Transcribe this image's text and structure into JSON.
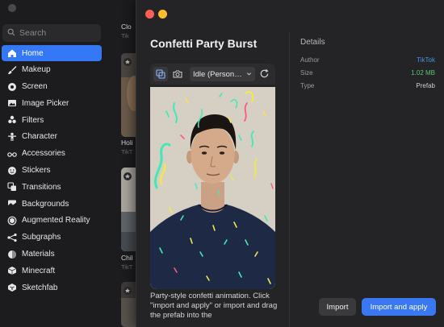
{
  "library": {
    "search": {
      "placeholder": "Search"
    },
    "nav": [
      {
        "label": "Home",
        "icon": "home-icon",
        "active": true
      },
      {
        "label": "Makeup",
        "icon": "brush-icon"
      },
      {
        "label": "Screen",
        "icon": "screen-icon"
      },
      {
        "label": "Image Picker",
        "icon": "image-icon"
      },
      {
        "label": "Filters",
        "icon": "filters-icon"
      },
      {
        "label": "Character",
        "icon": "character-icon"
      },
      {
        "label": "Accessories",
        "icon": "glasses-icon"
      },
      {
        "label": "Stickers",
        "icon": "sticker-icon"
      },
      {
        "label": "Transitions",
        "icon": "transitions-icon"
      },
      {
        "label": "Backgrounds",
        "icon": "backgrounds-icon"
      },
      {
        "label": "Augmented Reality",
        "icon": "ar-icon"
      },
      {
        "label": "Subgraphs",
        "icon": "subgraph-icon"
      },
      {
        "label": "Materials",
        "icon": "materials-icon"
      },
      {
        "label": "Minecraft",
        "icon": "minecraft-icon"
      },
      {
        "label": "Sketchfab",
        "icon": "sketchfab-icon"
      }
    ],
    "thumbs": [
      {
        "label": "Clo",
        "sub": "Tik"
      },
      {
        "label": "Holi",
        "sub": "TikT"
      },
      {
        "label": "Chil",
        "sub": "TikT"
      }
    ]
  },
  "dialog": {
    "title": "Confetti Party Burst",
    "preview": {
      "mode_select": "Idle (Person…"
    },
    "description": "Party-style confetti animation. Click \"import and apply\" or import and drag the prefab into the",
    "details": {
      "heading": "Details",
      "rows": [
        {
          "key": "Author",
          "value": "TikTok"
        },
        {
          "key": "Size",
          "value": "1.02 MB"
        },
        {
          "key": "Type",
          "value": "Prefab"
        }
      ]
    },
    "buttons": {
      "import": "Import",
      "apply": "Import and apply"
    }
  },
  "colors": {
    "accent": "#3478f6",
    "link": "#4a90e2",
    "size_green": "#57c774",
    "close": "#ff5f57",
    "minimize": "#febc2e"
  }
}
